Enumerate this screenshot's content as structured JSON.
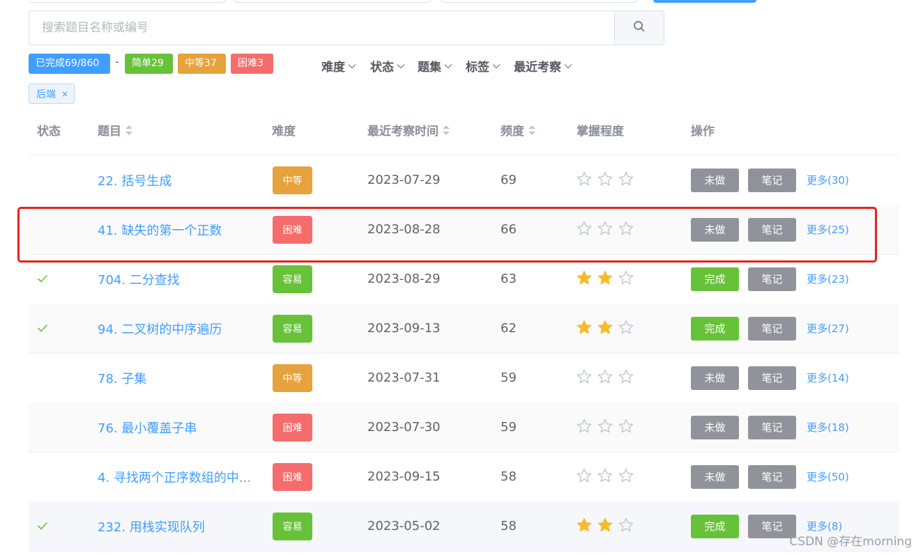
{
  "search": {
    "placeholder": "搜索题目名称或编号"
  },
  "stats": {
    "completed": "已完成69/860",
    "separator": "-",
    "easy": "简单29",
    "medium": "中等37",
    "hard": "困难3"
  },
  "filters": [
    "难度",
    "状态",
    "题集",
    "标签",
    "最近考察"
  ],
  "active_tag": {
    "label": "后端",
    "close": "×"
  },
  "table": {
    "headers": {
      "status": "状态",
      "title": "题目",
      "difficulty": "难度",
      "date": "最近考察时间",
      "frequency": "频度",
      "mastery": "掌握程度",
      "actions": "操作"
    },
    "rows": [
      {
        "done": false,
        "title": "22. 括号生成",
        "difficulty": "中等",
        "level": "mid",
        "date": "2023-07-29",
        "freq": "69",
        "stars": 0,
        "action": "未做",
        "note": "笔记",
        "more": "更多(30)"
      },
      {
        "done": false,
        "title": "41. 缺失的第一个正数",
        "difficulty": "困难",
        "level": "hard",
        "date": "2023-08-28",
        "freq": "66",
        "stars": 0,
        "action": "未做",
        "note": "笔记",
        "more": "更多(25)"
      },
      {
        "done": true,
        "title": "704. 二分查找",
        "difficulty": "容易",
        "level": "easy",
        "date": "2023-08-29",
        "freq": "63",
        "stars": 2,
        "action": "完成",
        "note": "笔记",
        "more": "更多(23)"
      },
      {
        "done": true,
        "title": "94. 二叉树的中序遍历",
        "difficulty": "容易",
        "level": "easy",
        "date": "2023-09-13",
        "freq": "62",
        "stars": 2,
        "action": "完成",
        "note": "笔记",
        "more": "更多(27)"
      },
      {
        "done": false,
        "title": "78. 子集",
        "difficulty": "中等",
        "level": "mid",
        "date": "2023-07-31",
        "freq": "59",
        "stars": 0,
        "action": "未做",
        "note": "笔记",
        "more": "更多(14)"
      },
      {
        "done": false,
        "title": "76. 最小覆盖子串",
        "difficulty": "困难",
        "level": "hard",
        "date": "2023-07-30",
        "freq": "59",
        "stars": 0,
        "action": "未做",
        "note": "笔记",
        "more": "更多(18)"
      },
      {
        "done": false,
        "title": "4. 寻找两个正序数组的中...",
        "difficulty": "困难",
        "level": "hard",
        "date": "2023-09-15",
        "freq": "58",
        "stars": 0,
        "action": "未做",
        "note": "笔记",
        "more": "更多(50)"
      },
      {
        "done": true,
        "title": "232. 用栈实现队列",
        "difficulty": "容易",
        "level": "easy",
        "date": "2023-05-02",
        "freq": "58",
        "stars": 2,
        "action": "完成",
        "note": "笔记",
        "more": "更多(8)"
      }
    ]
  },
  "watermark": "CSDN @存在morning",
  "colors": {
    "primary": "#409eff",
    "success": "#67c23a",
    "warning": "#e6a23c",
    "danger": "#f56c6c",
    "info": "#909399",
    "highlight": "#e8211b"
  }
}
